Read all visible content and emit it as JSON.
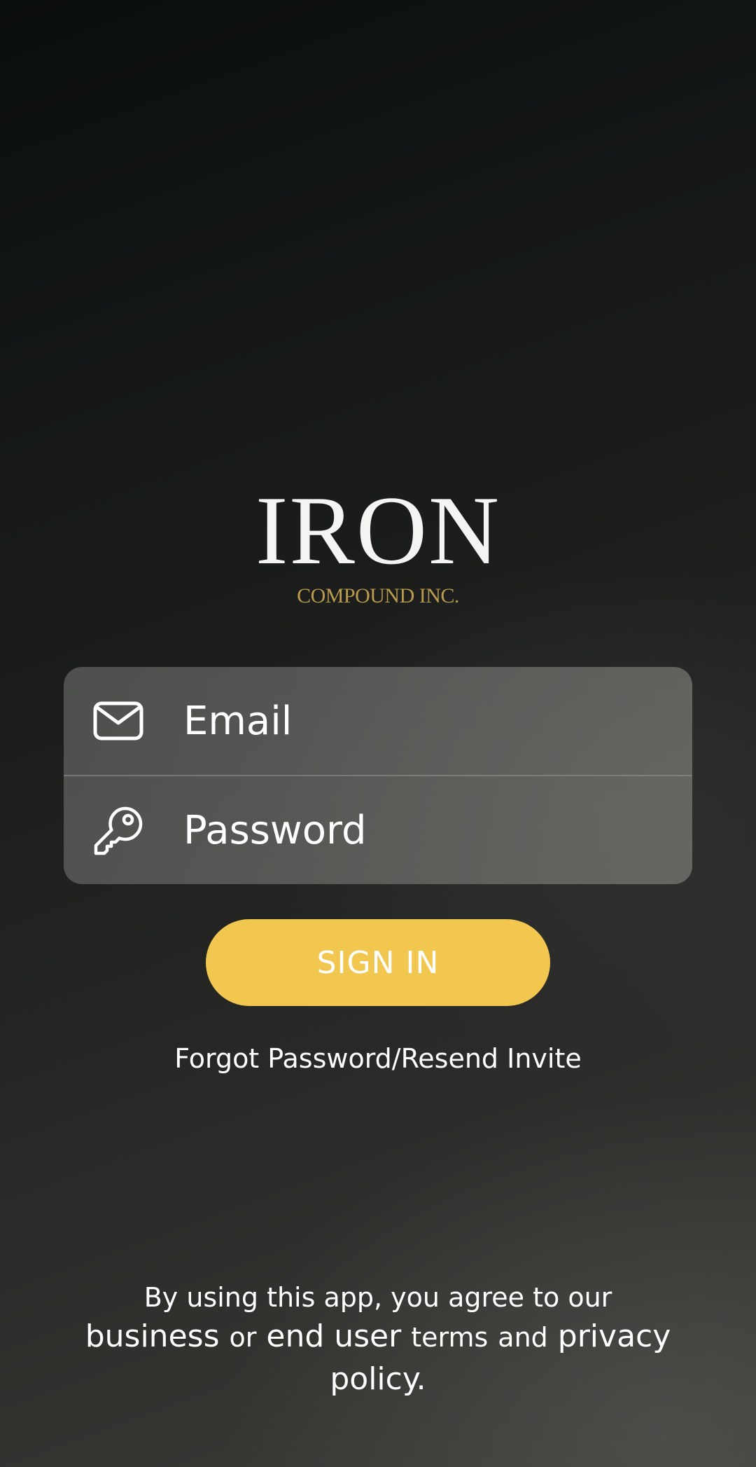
{
  "logo": {
    "main": "IRON",
    "sub": "COMPOUND INC."
  },
  "login": {
    "email": {
      "icon": "envelope-icon",
      "placeholder": "Email",
      "value": ""
    },
    "password": {
      "icon": "key-icon",
      "placeholder": "Password",
      "value": ""
    }
  },
  "signin_label": "SIGN IN",
  "forgot_label": "Forgot Password/Resend Invite",
  "terms": {
    "line1": "By using this app, you agree to our",
    "business": "business",
    "or": "or",
    "end_user": "end user",
    "terms_word": "terms",
    "and": "and",
    "privacy": "privacy",
    "policy": "policy",
    "period": "."
  },
  "colors": {
    "accent": "#f2c74f",
    "logo_gold": "#b99a4e"
  }
}
